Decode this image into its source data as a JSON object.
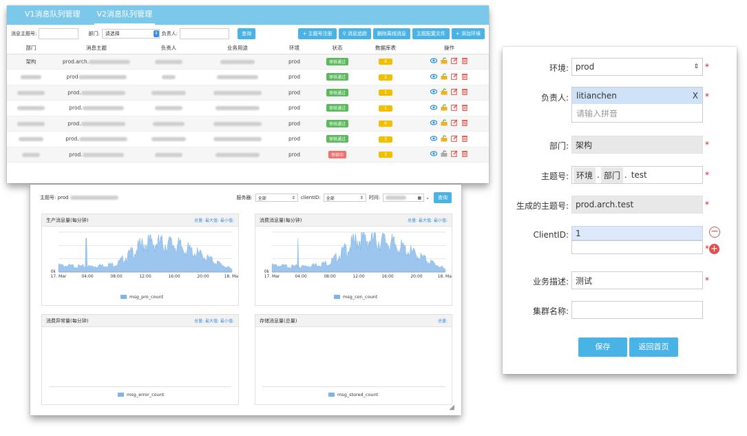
{
  "list_panel": {
    "tabs": [
      "V1消息队列管理",
      "V2消息队列管理"
    ],
    "filter": {
      "topic_label": "消息主题号:",
      "dept_label": "部门:",
      "dept_value": "请选择",
      "owner_label": "负责人:",
      "query_button": "查询"
    },
    "action_buttons": [
      "+ 主题号注册",
      "消息追踪",
      "删除离线消息",
      "主题配置文件",
      "+ 添加环境"
    ],
    "columns": [
      "部门",
      "消息主题",
      "负责人",
      "业务用途",
      "环境",
      "状态",
      "数据库表",
      "操作"
    ],
    "rows": [
      {
        "dept": "架构",
        "topic": "prod.arch.",
        "env": "prod",
        "status": "审核通过",
        "status_color": "#5cb85c",
        "db": "0"
      },
      {
        "dept": "",
        "topic": "prod",
        "env": "prod",
        "status": "审核通过",
        "status_color": "#5cb85c",
        "db": "2"
      },
      {
        "dept": "",
        "topic": "prod.",
        "env": "prod",
        "status": "审核通过",
        "status_color": "#5cb85c",
        "db": "1"
      },
      {
        "dept": "",
        "topic": "prod.",
        "env": "prod",
        "status": "审核通过",
        "status_color": "#5cb85c",
        "db": "1"
      },
      {
        "dept": "",
        "topic": "prod.",
        "env": "prod",
        "status": "审核通过",
        "status_color": "#5cb85c",
        "db": "0"
      },
      {
        "dept": "",
        "topic": "prod.",
        "env": "prod",
        "status": "审核通过",
        "status_color": "#5cb85c",
        "db": "3"
      },
      {
        "dept": "",
        "topic": "prod.",
        "env": "prod",
        "status": "审核中",
        "status_color": "#f07070",
        "db": "3"
      }
    ]
  },
  "dashboard": {
    "topic_label": "主题号: prod",
    "server_label": "服务器:",
    "server_value": "全部",
    "client_label": "clientID:",
    "client_value": "全部",
    "time_label": "时间:",
    "query_button": "查询",
    "cards": [
      {
        "title": "生产消息量(每分钟)",
        "stats": "总量:    最大值:    最小值:",
        "legend": "msg_pro_count"
      },
      {
        "title": "消费消息量(每分钟)",
        "stats": "总量:    最大值:    最小值:",
        "legend": "msg_con_count"
      },
      {
        "title": "消费异常量(每分钟)",
        "stats": "总量:   最大值:   最小值:",
        "legend": "msg_error_count"
      },
      {
        "title": "存储消息量(总量)",
        "stats": "总量:",
        "legend": "msg_stored_count"
      }
    ],
    "x_ticks": [
      "17. Mar",
      "04:00",
      "08:00",
      "12:00",
      "16:00",
      "20:00",
      "18. Mar"
    ],
    "y_tick_zero": "0k"
  },
  "chart_data": [
    {
      "type": "area",
      "title": "生产消息量(每分钟)",
      "x": [
        "17. Mar",
        "04:00",
        "08:00",
        "12:00",
        "16:00",
        "20:00",
        "18. Mar"
      ],
      "series": [
        {
          "name": "msg_pro_count",
          "values": [
            0.5,
            0.4,
            0.6,
            2.2,
            2.1,
            1.2,
            0.2
          ]
        }
      ]
    },
    {
      "type": "area",
      "title": "消费消息量(每分钟)",
      "x": [
        "17. Mar",
        "04:00",
        "08:00",
        "12:00",
        "16:00",
        "20:00",
        "18. Mar"
      ],
      "series": [
        {
          "name": "msg_con_count",
          "values": [
            0.5,
            0.4,
            0.7,
            2.5,
            2.3,
            1.3,
            0.2
          ]
        }
      ]
    }
  ],
  "form": {
    "env_label": "环境:",
    "env_value": "prod",
    "owner_label": "负责人:",
    "owner_tag": "litianchen",
    "owner_placeholder": "请输入拼音",
    "dept_label": "部门:",
    "dept_value": "架构",
    "topic_label": "主题号:",
    "topic_parts": [
      "环境",
      "部门",
      "test"
    ],
    "generated_label": "生成的主题号:",
    "generated_value": "prod.arch.test",
    "client_label": "ClientID:",
    "client_value": "1",
    "desc_label": "业务描述:",
    "desc_value": "测试",
    "cluster_label": "集群名称:",
    "save_button": "保存",
    "back_button": "返回首页"
  }
}
